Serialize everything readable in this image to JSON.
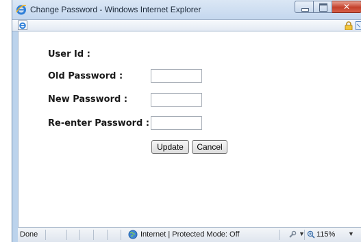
{
  "window": {
    "title": "Change Password - Windows Internet Explorer"
  },
  "form": {
    "user_id_label": "User Id :",
    "old_password_label": "Old Password :",
    "new_password_label": "New Password :",
    "reenter_password_label": "Re-enter Password :",
    "old_password_value": "",
    "new_password_value": "",
    "reenter_password_value": "",
    "update_label": "Update",
    "cancel_label": "Cancel"
  },
  "status": {
    "left_text": "Done",
    "zone_text": "Internet | Protected Mode: Off",
    "zoom_text": "115%"
  },
  "icons": {
    "title_icon": "ie-icon",
    "page_icon": "ie-page-icon",
    "lock": "lock-icon",
    "zone": "globe-icon",
    "zoom": "zoom-icon"
  },
  "colors": {
    "frame": "#bcd3ec",
    "close_button": "#c4402b"
  }
}
